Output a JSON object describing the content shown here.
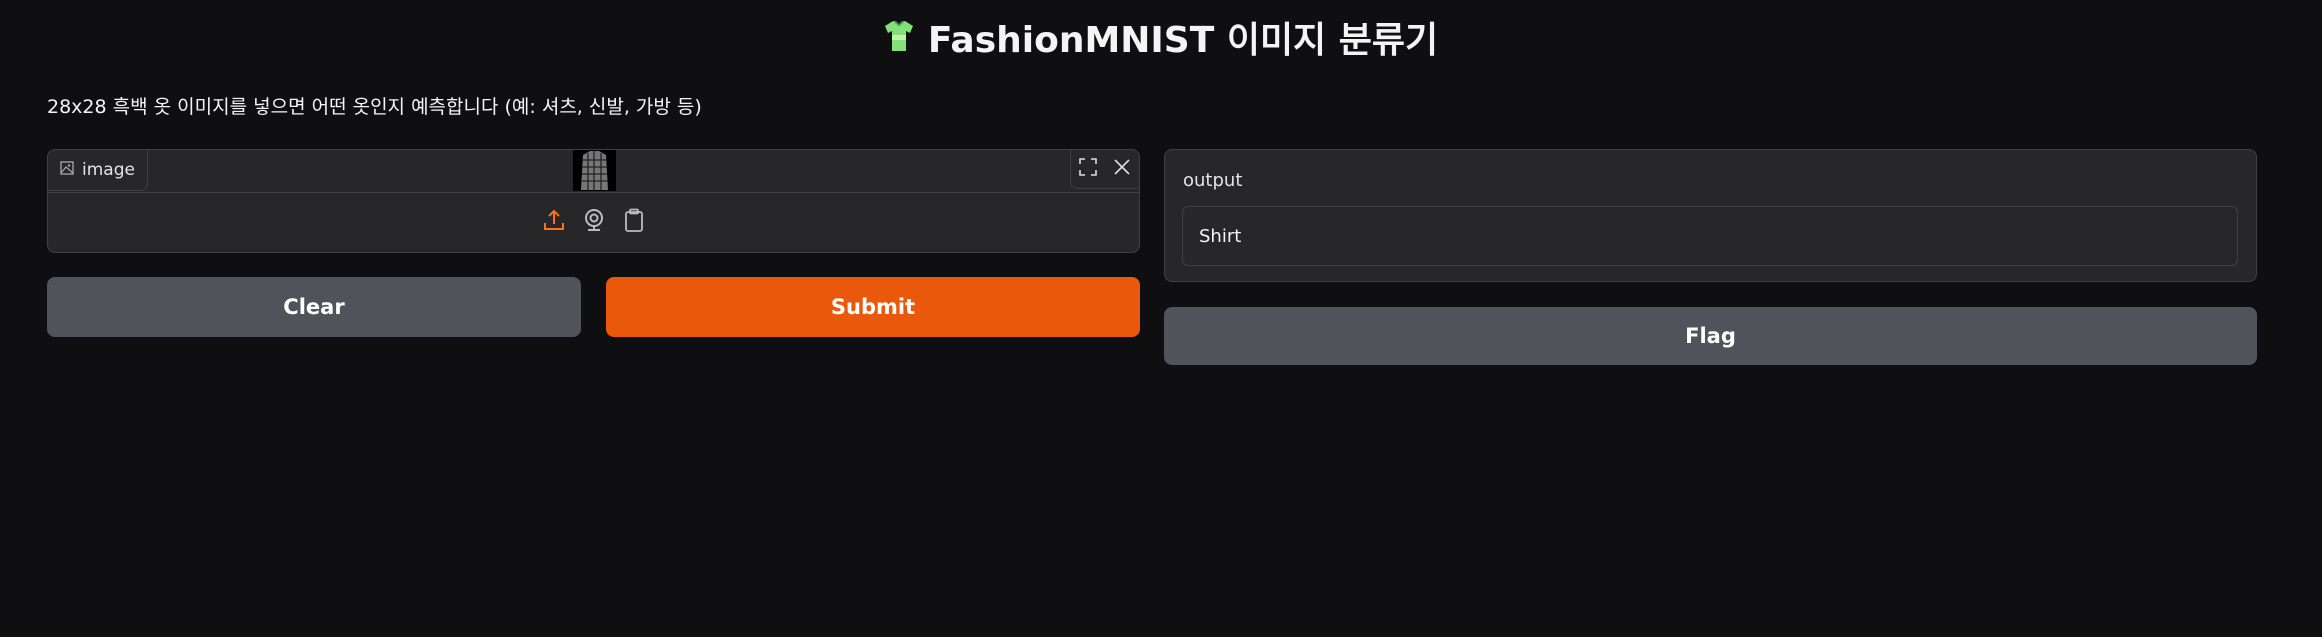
{
  "header": {
    "title": "FashionMNIST 이미지 분류기",
    "emoji": "t-shirt-icon"
  },
  "description": "28x28 흑백 옷 이미지를 넣으면 어떤 옷인지 예측합니다 (예: 셔츠, 신발, 가방 등)",
  "input": {
    "label": "image",
    "sources": [
      "upload-icon",
      "webcam-icon",
      "clipboard-icon"
    ]
  },
  "buttons": {
    "clear": "Clear",
    "submit": "Submit",
    "flag": "Flag"
  },
  "output": {
    "label": "output",
    "value": "Shirt"
  },
  "colors": {
    "background": "#0f0f11",
    "panel": "#27272a",
    "accent": "#ea580c",
    "secondary": "#52525b"
  }
}
